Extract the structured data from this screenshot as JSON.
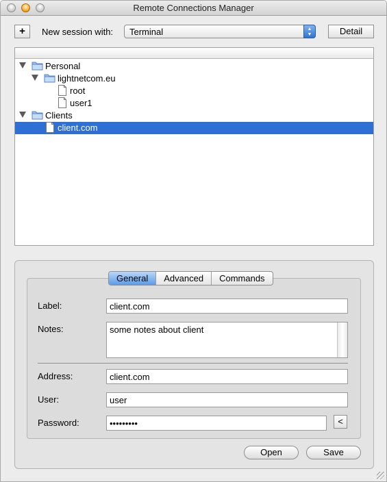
{
  "window": {
    "title": "Remote Connections Manager"
  },
  "toolbar": {
    "add_label": "+",
    "new_session_label": "New session with:",
    "session_type": "Terminal",
    "detail_label": "Detail"
  },
  "tree": {
    "items": [
      {
        "label": "Personal",
        "kind": "folder",
        "expanded": true
      },
      {
        "label": "lightnetcom.eu",
        "kind": "folder",
        "expanded": true
      },
      {
        "label": "root",
        "kind": "document"
      },
      {
        "label": "user1",
        "kind": "document"
      },
      {
        "label": "Clients",
        "kind": "folder",
        "expanded": true
      },
      {
        "label": "client.com",
        "kind": "document",
        "selected": true
      }
    ]
  },
  "tabs": [
    {
      "label": "General",
      "active": true
    },
    {
      "label": "Advanced",
      "active": false
    },
    {
      "label": "Commands",
      "active": false
    }
  ],
  "form": {
    "label_caption": "Label:",
    "label_value": "client.com",
    "notes_caption": "Notes:",
    "notes_value": "some notes about client",
    "address_caption": "Address:",
    "address_value": "client.com",
    "user_caption": "User:",
    "user_value": "user",
    "password_caption": "Password:",
    "password_value": "•••••••••",
    "reveal_label": "<"
  },
  "actions": {
    "open_label": "Open",
    "save_label": "Save"
  },
  "colors": {
    "selection": "#2d6fd5",
    "active_tab": "#5c9ce8"
  }
}
